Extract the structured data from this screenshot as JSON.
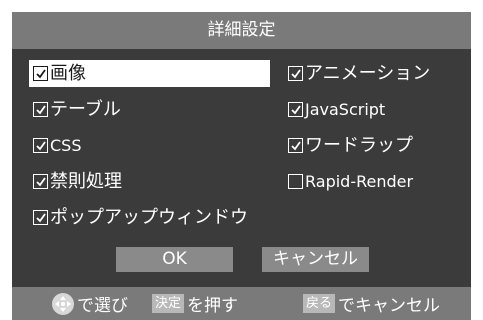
{
  "dialog": {
    "title": "詳細設定"
  },
  "options": [
    {
      "id": "image",
      "label": "画像",
      "checked": true
    },
    {
      "id": "animation",
      "label": "アニメーション",
      "checked": true
    },
    {
      "id": "table",
      "label": "テーブル",
      "checked": true
    },
    {
      "id": "javascript",
      "label": "JavaScript",
      "checked": true
    },
    {
      "id": "css",
      "label": "CSS",
      "checked": true
    },
    {
      "id": "wordwrap",
      "label": "ワードラップ",
      "checked": true
    },
    {
      "id": "kinsoku",
      "label": "禁則処理",
      "checked": true
    },
    {
      "id": "rapid_render",
      "label": "Rapid-Render",
      "checked": false
    },
    {
      "id": "popup",
      "label": "ポップアップウィンドウ",
      "checked": true
    }
  ],
  "buttons": {
    "ok": "OK",
    "cancel": "キャンセル"
  },
  "hints": {
    "select": "で選び",
    "confirm_key": "決定",
    "confirm_text": "を押す",
    "back_key": "戻る",
    "back_text": "でキャンセル"
  },
  "colors": {
    "dialog_bg": "#3b3b3b",
    "title_bg": "#7a7a7a",
    "button_bg": "#8a8a8a",
    "focus_bg": "#ffffff"
  }
}
